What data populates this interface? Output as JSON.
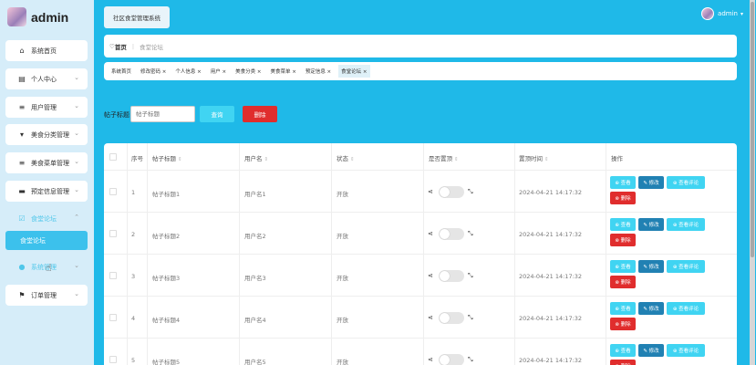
{
  "brand": {
    "name": "admin"
  },
  "sidebar": {
    "items": [
      {
        "label": "系统首页",
        "icon": "home-icon",
        "glyph": "⌂",
        "has_chevron": false
      },
      {
        "label": "个人中心",
        "icon": "calendar-icon",
        "glyph": "▤",
        "has_chevron": true
      },
      {
        "label": "用户管理",
        "icon": "list-icon",
        "glyph": "≡",
        "has_chevron": true
      },
      {
        "label": "美食分类管理",
        "icon": "category-icon",
        "glyph": "▾",
        "has_chevron": true
      },
      {
        "label": "美食菜单管理",
        "icon": "list-icon",
        "glyph": "≡",
        "has_chevron": true
      },
      {
        "label": "预定信息管理",
        "icon": "monitor-icon",
        "glyph": "▬",
        "has_chevron": true
      },
      {
        "label": "食堂论坛",
        "icon": "forum-icon",
        "glyph": "☑",
        "has_chevron": true,
        "active": true
      },
      {
        "label": "系统管理",
        "icon": "user-icon",
        "glyph": "●",
        "has_chevron": true,
        "active": true
      },
      {
        "label": "订单管理",
        "icon": "flag-icon",
        "glyph": "⚑",
        "has_chevron": true
      }
    ],
    "sub_item": "食堂论坛"
  },
  "header": {
    "site_title": "社区食堂管理系统",
    "username": "admin",
    "caret": "▾"
  },
  "breadcrumb": {
    "home": "首页",
    "home_glyph": "♡",
    "current": "食堂论坛"
  },
  "tabs": [
    "系统首页",
    "修改密码 ×",
    "个人信息 ×",
    "用户 ×",
    "美食分类 ×",
    "美食菜单 ×",
    "预定信息 ×",
    "食堂论坛 ×"
  ],
  "search": {
    "label": "帖子标题",
    "placeholder": "帖子标题",
    "query_button": "查询",
    "delete_button": "删除"
  },
  "table": {
    "headers": [
      "序号",
      "帖子标题",
      "用户名",
      "状态",
      "是否置顶",
      "置顶时间",
      "操作"
    ],
    "sort_glyph": "⇕",
    "rows": [
      {
        "index": "1",
        "title": "帖子标题1",
        "user": "用户名1",
        "status": "开放",
        "time": "2024-04-21 14:17:32"
      },
      {
        "index": "2",
        "title": "帖子标题2",
        "user": "用户名2",
        "status": "开放",
        "time": "2024-04-21 14:17:32"
      },
      {
        "index": "3",
        "title": "帖子标题3",
        "user": "用户名3",
        "status": "开放",
        "time": "2024-04-21 14:17:32"
      },
      {
        "index": "4",
        "title": "帖子标题4",
        "user": "用户名4",
        "status": "开放",
        "time": "2024-04-21 14:17:32"
      },
      {
        "index": "5",
        "title": "帖子标题5",
        "user": "用户名5",
        "status": "开放",
        "time": "2024-04-21 14:17:32"
      }
    ],
    "actions": {
      "view": "⊕ 查看",
      "edit": "✎ 修改",
      "comments": "⊕ 查看评论",
      "delete": "⊗ 删除"
    },
    "toggle_left_glyph": "⋖",
    "toggle_right_glyph": "⤡"
  },
  "colors": {
    "accent": "#1fb9e8",
    "danger": "#e02d2d",
    "edit": "#2181b3",
    "light": "#40d4f2"
  }
}
